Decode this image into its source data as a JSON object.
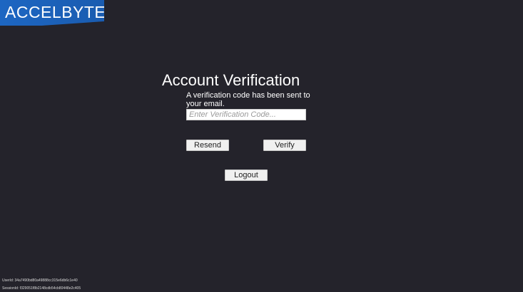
{
  "logo": {
    "text": "ACCELBYTE",
    "color": "#1d66c2"
  },
  "verification": {
    "title": "Account Verification",
    "message": "A verification code has been sent to your email.",
    "input_placeholder": "Enter Verification Code...",
    "input_value": ""
  },
  "buttons": {
    "resend": "Resend",
    "verify": "Verify",
    "logout": "Logout"
  },
  "footer": {
    "user_id": "UserId: 34a7490bd80a49888cc315e6db6c1e40",
    "session_id": "SessionId: f329051f8b2148cdb54cb80448e2c405"
  },
  "colors": {
    "background": "#24232b",
    "button_bg": "#f0f0f0"
  }
}
